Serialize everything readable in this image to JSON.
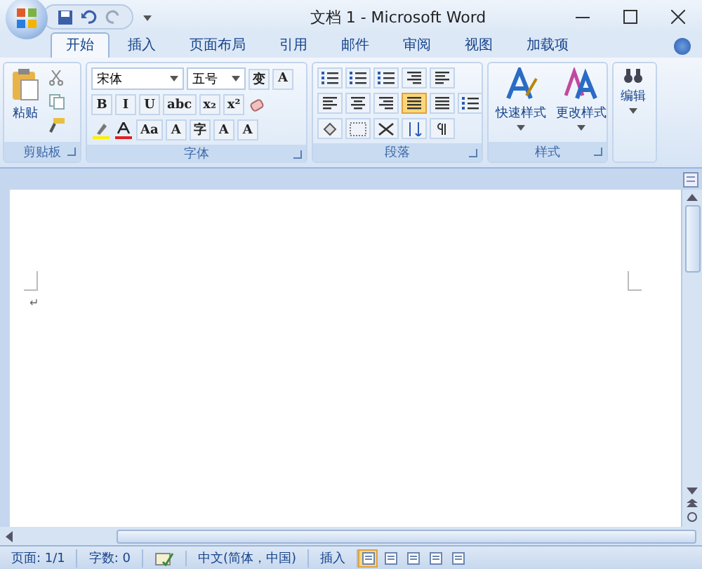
{
  "window": {
    "title": "文档 1 - Microsoft Word"
  },
  "tabs": [
    {
      "label": "开始",
      "selected": true
    },
    {
      "label": "插入",
      "selected": false
    },
    {
      "label": "页面布局",
      "selected": false
    },
    {
      "label": "引用",
      "selected": false
    },
    {
      "label": "邮件",
      "selected": false
    },
    {
      "label": "审阅",
      "selected": false
    },
    {
      "label": "视图",
      "selected": false
    },
    {
      "label": "加载项",
      "selected": false
    }
  ],
  "clipboard": {
    "paste": "粘贴",
    "label": "剪贴板"
  },
  "font": {
    "name": "宋体",
    "size": "五号",
    "label": "字体",
    "phonetic": "变",
    "border_char": "A",
    "format_buttons": [
      "B",
      "I",
      "U",
      "abc",
      "x₂",
      "x²"
    ],
    "effect_buttons": [
      "Aa",
      "A",
      "字",
      "A",
      "A"
    ]
  },
  "paragraph": {
    "label": "段落",
    "alignments": [
      {
        "kind": "left",
        "selected": false
      },
      {
        "kind": "center",
        "selected": false
      },
      {
        "kind": "right",
        "selected": false
      },
      {
        "kind": "justify",
        "selected": true
      },
      {
        "kind": "distributed",
        "selected": false
      }
    ]
  },
  "styles": {
    "quick": "快速样式",
    "change": "更改样式",
    "label": "样式"
  },
  "editing": {
    "label": "编辑"
  },
  "document": {
    "paragraph_mark": "↵"
  },
  "status_bar": {
    "page": "页面: 1/1",
    "words": "字数: 0",
    "language": "中文(简体，中国)",
    "mode": "插入"
  },
  "views": [
    {
      "selected": true
    },
    {
      "selected": false
    },
    {
      "selected": false
    },
    {
      "selected": false
    },
    {
      "selected": false
    }
  ]
}
